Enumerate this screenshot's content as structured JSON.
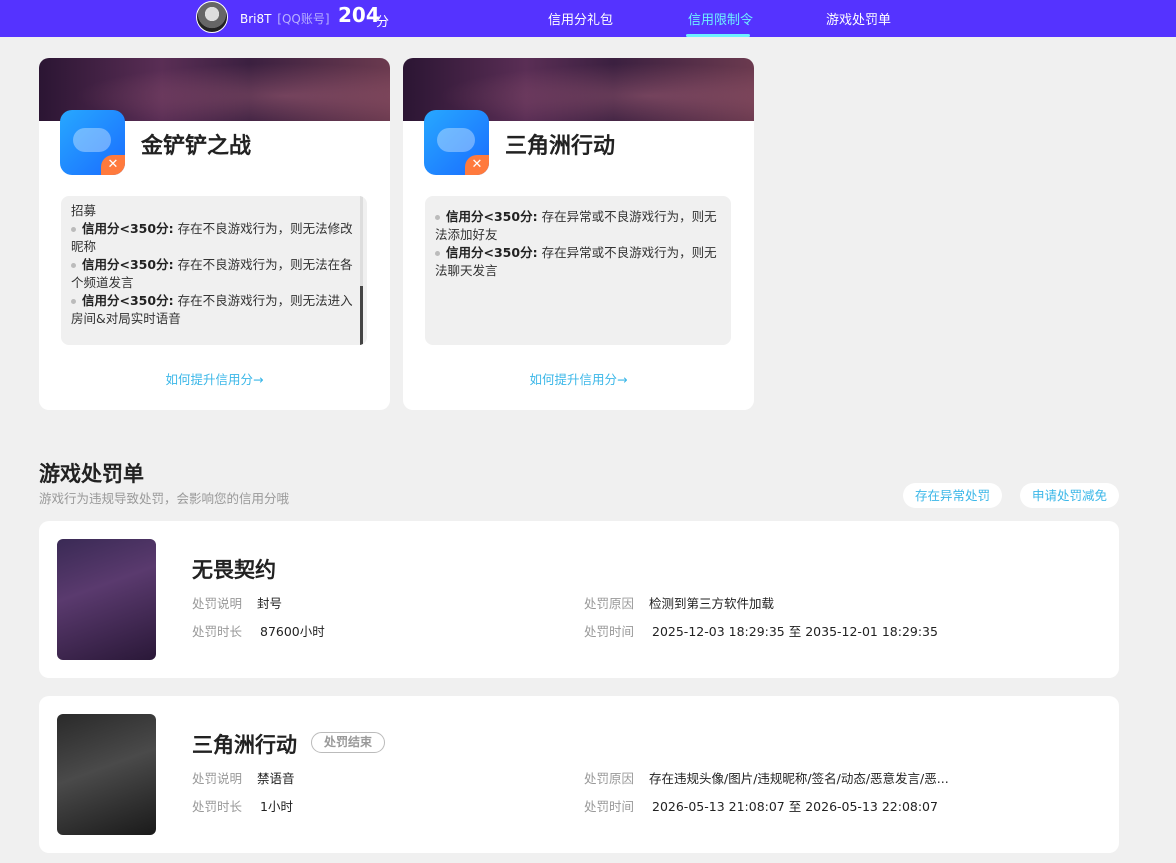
{
  "header": {
    "username": "Bri8T",
    "account_type": "[QQ账号]",
    "score": "204",
    "score_unit": "分",
    "nav": [
      {
        "label": "信用分礼包",
        "active": false
      },
      {
        "label": "信用限制令",
        "active": true
      },
      {
        "label": "游戏处罚单",
        "active": false
      }
    ]
  },
  "limit_cards": [
    {
      "name": "金铲铲之战",
      "partial_top": "招募",
      "rules": [
        {
          "key": "信用分<350分:",
          "text": "存在不良游戏行为，则无法修改昵称"
        },
        {
          "key": "信用分<350分:",
          "text": "存在不良游戏行为，则无法在各个频道发言"
        },
        {
          "key": "信用分<350分:",
          "text": "存在不良游戏行为，则无法进入房间&对局实时语音"
        }
      ],
      "link": "如何提升信用分→"
    },
    {
      "name": "三角洲行动",
      "partial_top": "",
      "rules": [
        {
          "key": "信用分<350分:",
          "text": "存在异常或不良游戏行为，则无法添加好友"
        },
        {
          "key": "信用分<350分:",
          "text": "存在异常或不良游戏行为，则无法聊天发言"
        }
      ],
      "link": "如何提升信用分→"
    }
  ],
  "punish_section": {
    "title": "游戏处罚单",
    "subtitle": "游戏行为违规导致处罚，会影响您的信用分哦",
    "btn_abnormal": "存在异常处罚",
    "btn_apply": "申请处罚减免"
  },
  "punishments": [
    {
      "game": "无畏契约",
      "status": "",
      "desc_label": "处罚说明",
      "desc": "封号",
      "duration_label": "处罚时长",
      "duration": "87600小时",
      "reason_label": "处罚原因",
      "reason": "检测到第三方软件加载",
      "time_label": "处罚时间",
      "time": "2025-12-03 18:29:35 至 2035-12-01 18:29:35"
    },
    {
      "game": "三角洲行动",
      "status": "处罚结束",
      "desc_label": "处罚说明",
      "desc": "禁语音",
      "duration_label": "处罚时长",
      "duration": "1小时",
      "reason_label": "处罚原因",
      "reason": "存在违规头像/图片/违规昵称/签名/动态/恶意发言/恶...",
      "time_label": "处罚时间",
      "time": "2026-05-13 21:08:07 至 2026-05-13 22:08:07"
    }
  ]
}
